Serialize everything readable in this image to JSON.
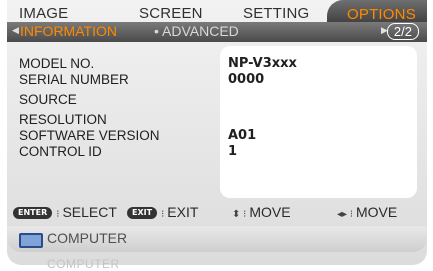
{
  "tabs": [
    "IMAGE",
    "SCREEN",
    "SETTING",
    "OPTIONS"
  ],
  "subtabs": {
    "active": "INFORMATION",
    "other": "ADVANCED",
    "page": "2/2"
  },
  "info": {
    "labels": [
      "MODEL NO.",
      "SERIAL NUMBER",
      "SOURCE",
      "RESOLUTION",
      "SOFTWARE VERSION",
      "CONTROL ID"
    ],
    "values": [
      "NP-V3xxx",
      "0000",
      "",
      "",
      "A01",
      "1"
    ]
  },
  "help": {
    "enter_key": "ENTER",
    "enter_label": "SELECT",
    "exit_key": "EXIT",
    "exit_label": "EXIT",
    "move_label": "MOVE"
  },
  "source": {
    "label": "COMPUTER",
    "ghost": "COMPUTER"
  },
  "colors": {
    "accent": "#ff8a00",
    "bar": "#4a4a4a",
    "panel": "#ffffff"
  }
}
